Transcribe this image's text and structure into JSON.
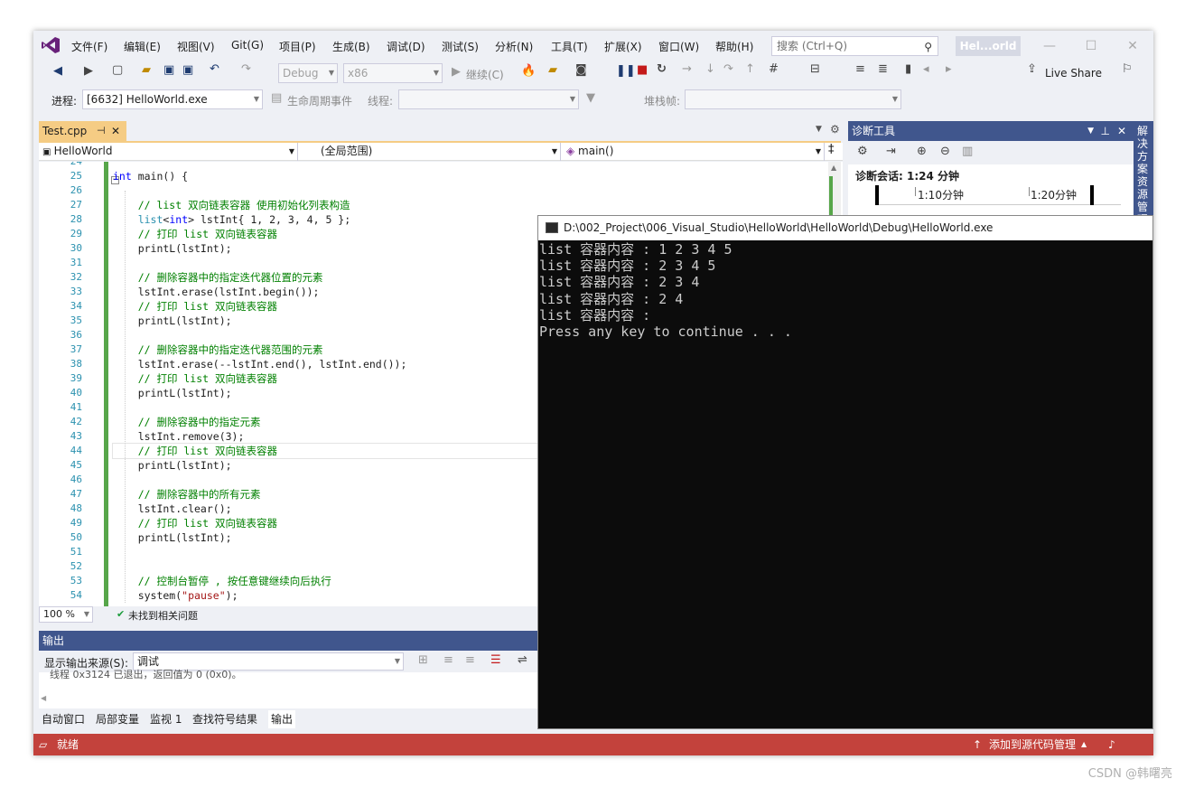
{
  "menu": {
    "items": [
      "文件(F)",
      "编辑(E)",
      "视图(V)",
      "Git(G)",
      "项目(P)",
      "生成(B)",
      "调试(D)",
      "测试(S)",
      "分析(N)",
      "工具(T)",
      "扩展(X)",
      "窗口(W)",
      "帮助(H)"
    ],
    "search_placeholder": "搜索 (Ctrl+Q)",
    "solution_title": "Hel...orld"
  },
  "toolbar": {
    "config": "Debug",
    "platform": "x86",
    "continue_label": "继续(C)",
    "live_share": "Live Share"
  },
  "debugbar": {
    "process_label": "进程:",
    "process_value": "[6632] HelloWorld.exe",
    "lifecycle_label": "生命周期事件",
    "thread_label": "线程:",
    "stack_label": "堆栈帧:"
  },
  "editor": {
    "tab_name": "Test.cpp",
    "project_combo": "HelloWorld",
    "scope_combo": "(全局范围)",
    "function_combo": "main()",
    "zoom": "100 %",
    "issues": "未找到相关问题",
    "lines": [
      {
        "n": "24",
        "t": ""
      },
      {
        "n": "25",
        "t": "int main() {"
      },
      {
        "n": "26",
        "t": ""
      },
      {
        "n": "27",
        "t": "    // list 双向链表容器 使用初始化列表构造"
      },
      {
        "n": "28",
        "t": "    list<int> lstInt{ 1, 2, 3, 4, 5 };"
      },
      {
        "n": "29",
        "t": "    // 打印 list 双向链表容器"
      },
      {
        "n": "30",
        "t": "    printL(lstInt);"
      },
      {
        "n": "31",
        "t": ""
      },
      {
        "n": "32",
        "t": "    // 删除容器中的指定迭代器位置的元素"
      },
      {
        "n": "33",
        "t": "    lstInt.erase(lstInt.begin());"
      },
      {
        "n": "34",
        "t": "    // 打印 list 双向链表容器"
      },
      {
        "n": "35",
        "t": "    printL(lstInt);"
      },
      {
        "n": "36",
        "t": ""
      },
      {
        "n": "37",
        "t": "    // 删除容器中的指定迭代器范围的元素"
      },
      {
        "n": "38",
        "t": "    lstInt.erase(--lstInt.end(), lstInt.end());"
      },
      {
        "n": "39",
        "t": "    // 打印 list 双向链表容器"
      },
      {
        "n": "40",
        "t": "    printL(lstInt);"
      },
      {
        "n": "41",
        "t": ""
      },
      {
        "n": "42",
        "t": "    // 删除容器中的指定元素"
      },
      {
        "n": "43",
        "t": "    lstInt.remove(3);"
      },
      {
        "n": "44",
        "t": "    // 打印 list 双向链表容器"
      },
      {
        "n": "45",
        "t": "    printL(lstInt);"
      },
      {
        "n": "46",
        "t": ""
      },
      {
        "n": "47",
        "t": "    // 删除容器中的所有元素"
      },
      {
        "n": "48",
        "t": "    lstInt.clear();"
      },
      {
        "n": "49",
        "t": "    // 打印 list 双向链表容器"
      },
      {
        "n": "50",
        "t": "    printL(lstInt);"
      },
      {
        "n": "51",
        "t": ""
      },
      {
        "n": "52",
        "t": ""
      },
      {
        "n": "53",
        "t": "    // 控制台暂停 , 按任意键继续向后执行"
      },
      {
        "n": "54",
        "t": "    system(\"pause\");"
      }
    ]
  },
  "output": {
    "title": "输出",
    "source_label": "显示输出来源(S):",
    "source_value": "调试",
    "text": "线程 0x3124 已退出，返回值为 0 (0x0)。",
    "tabs": [
      "自动窗口",
      "局部变量",
      "监视 1",
      "查找符号结果",
      "输出"
    ]
  },
  "diagnostics": {
    "title": "诊断工具",
    "session": "诊断会话: 1:24 分钟",
    "tick1": "1:10分钟",
    "tick2": "1:20分钟",
    "side_label": "解决方案资源管理器"
  },
  "console": {
    "title": "D:\\002_Project\\006_Visual_Studio\\HelloWorld\\HelloWorld\\Debug\\HelloWorld.exe",
    "lines": [
      "list 容器内容 : 1 2 3 4 5",
      "list 容器内容 : 2 3 4 5",
      "list 容器内容 : 2 3 4",
      "list 容器内容 : 2 4",
      "list 容器内容 :",
      "Press any key to continue . . ."
    ]
  },
  "statusbar": {
    "ready": "就绪",
    "source_control": "添加到源代码管理"
  },
  "watermark": "CSDN @韩曙亮",
  "colors": {
    "statusbar": "#c3423c",
    "panel_header": "#40568d",
    "tab_active": "#f5cc84"
  }
}
